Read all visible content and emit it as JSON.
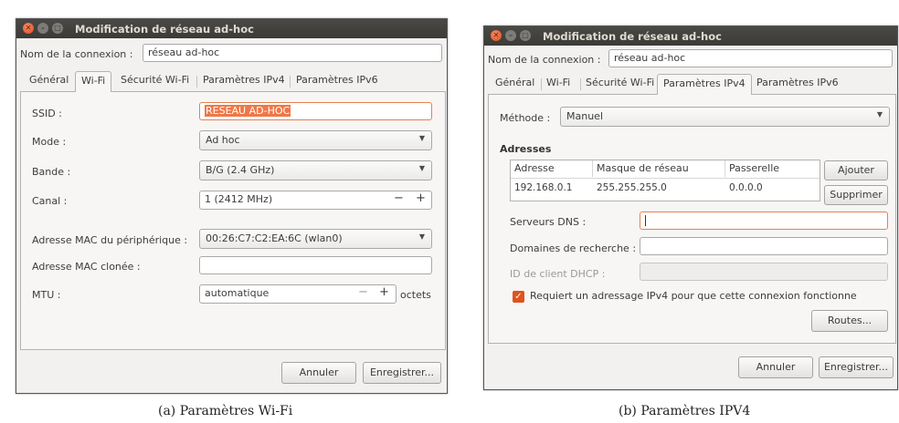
{
  "left": {
    "title": "Modification de réseau ad-hoc",
    "conn_label": "Nom de la connexion :",
    "conn_value": "réseau ad-hoc",
    "tabs": [
      "Général",
      "Wi-Fi",
      "Sécurité Wi-Fi",
      "Paramètres IPv4",
      "Paramètres IPv6"
    ],
    "fields": {
      "ssid_label": "SSID :",
      "ssid_value": "RESEAU AD-HOC",
      "mode_label": "Mode :",
      "mode_value": "Ad hoc",
      "band_label": "Bande :",
      "band_value": "B/G (2.4 GHz)",
      "channel_label": "Canal :",
      "channel_value": "1 (2412 MHz)",
      "mac_label": "Adresse MAC du périphérique :",
      "mac_value": "00:26:C7:C2:EA:6C (wlan0)",
      "cloned_label": "Adresse MAC clonée :",
      "cloned_value": "",
      "mtu_label": "MTU :",
      "mtu_value": "automatique",
      "mtu_unit": "octets"
    },
    "cancel": "Annuler",
    "save": "Enregistrer...",
    "caption": "(a)  Paramètres Wi-Fi"
  },
  "right": {
    "title": "Modification de réseau ad-hoc",
    "conn_label": "Nom de la connexion :",
    "conn_value": "réseau ad-hoc",
    "tabs": [
      "Général",
      "Wi-Fi",
      "Sécurité Wi-Fi",
      "Paramètres IPv4",
      "Paramètres IPv6"
    ],
    "method_label": "Méthode :",
    "method_value": "Manuel",
    "addresses_heading": "Adresses",
    "columns": [
      "Adresse",
      "Masque de réseau",
      "Passerelle"
    ],
    "rows": [
      [
        "192.168.0.1",
        "255.255.255.0",
        "0.0.0.0"
      ]
    ],
    "add": "Ajouter",
    "remove": "Supprimer",
    "dns_label": "Serveurs DNS :",
    "dns_value": "",
    "domains_label": "Domaines de recherche :",
    "domains_value": "",
    "dhcp_label": "ID de client DHCP :",
    "dhcp_value": "",
    "require_label": "Requiert un adressage IPv4 pour que cette connexion fonctionne",
    "routes": "Routes...",
    "cancel": "Annuler",
    "save": "Enregistrer...",
    "caption": "(b)  Paramètres IPV4"
  },
  "colors": {
    "accent": "#f07746",
    "titlebar": "#3c3b37",
    "window_bg": "#f2f1f0",
    "close_button": "#df4a16"
  },
  "icons": [
    "close-icon",
    "minimize-icon",
    "maximize-icon",
    "chevron-down-icon",
    "minus-icon",
    "plus-icon",
    "checkmark-icon"
  ]
}
